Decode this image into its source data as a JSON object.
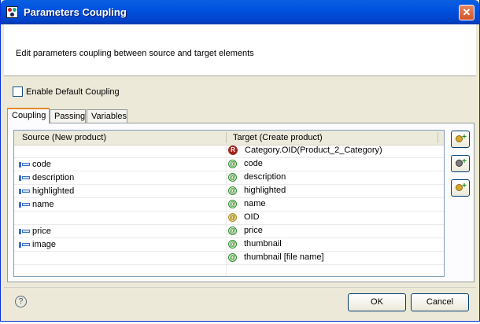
{
  "window": {
    "title": "Parameters Coupling",
    "close_label": "✕"
  },
  "header": {
    "description": "Edit parameters coupling between source and target elements"
  },
  "options": {
    "enable_default_coupling": "Enable Default Coupling",
    "enable_default_coupling_checked": false
  },
  "tabs": [
    {
      "label": "Coupling",
      "active": true
    },
    {
      "label": "Passing",
      "active": false
    },
    {
      "label": "Variables",
      "active": false
    }
  ],
  "table": {
    "columns": {
      "source": "Source (New product)",
      "target": "Target (Create product)"
    },
    "rows": [
      {
        "source": "",
        "target": "Category.OID(Product_2_Category)",
        "target_icon": "relationship-icon"
      },
      {
        "source": "code",
        "target": "code",
        "target_icon": "attribute-icon"
      },
      {
        "source": "description",
        "target": "description",
        "target_icon": "attribute-icon"
      },
      {
        "source": "highlighted",
        "target": "highlighted",
        "target_icon": "attribute-icon"
      },
      {
        "source": "name",
        "target": "name",
        "target_icon": "attribute-icon"
      },
      {
        "source": "",
        "target": "OID",
        "target_icon": "key-attribute-icon"
      },
      {
        "source": "price",
        "target": "price",
        "target_icon": "attribute-icon"
      },
      {
        "source": "image",
        "target": "thumbnail",
        "target_icon": "attribute-icon"
      },
      {
        "source": "",
        "target": "thumbnail [file name]",
        "target_icon": "attribute-icon"
      }
    ]
  },
  "icons": {
    "at_glyph": "@",
    "relationship_glyph": "R",
    "help_glyph": "?",
    "add_glyph": "+"
  },
  "buttons": {
    "ok": "OK",
    "cancel": "Cancel"
  },
  "colors": {
    "title_bar": "#0052e0",
    "tab_accent": "#e68b2c",
    "close": "#d4532b"
  }
}
